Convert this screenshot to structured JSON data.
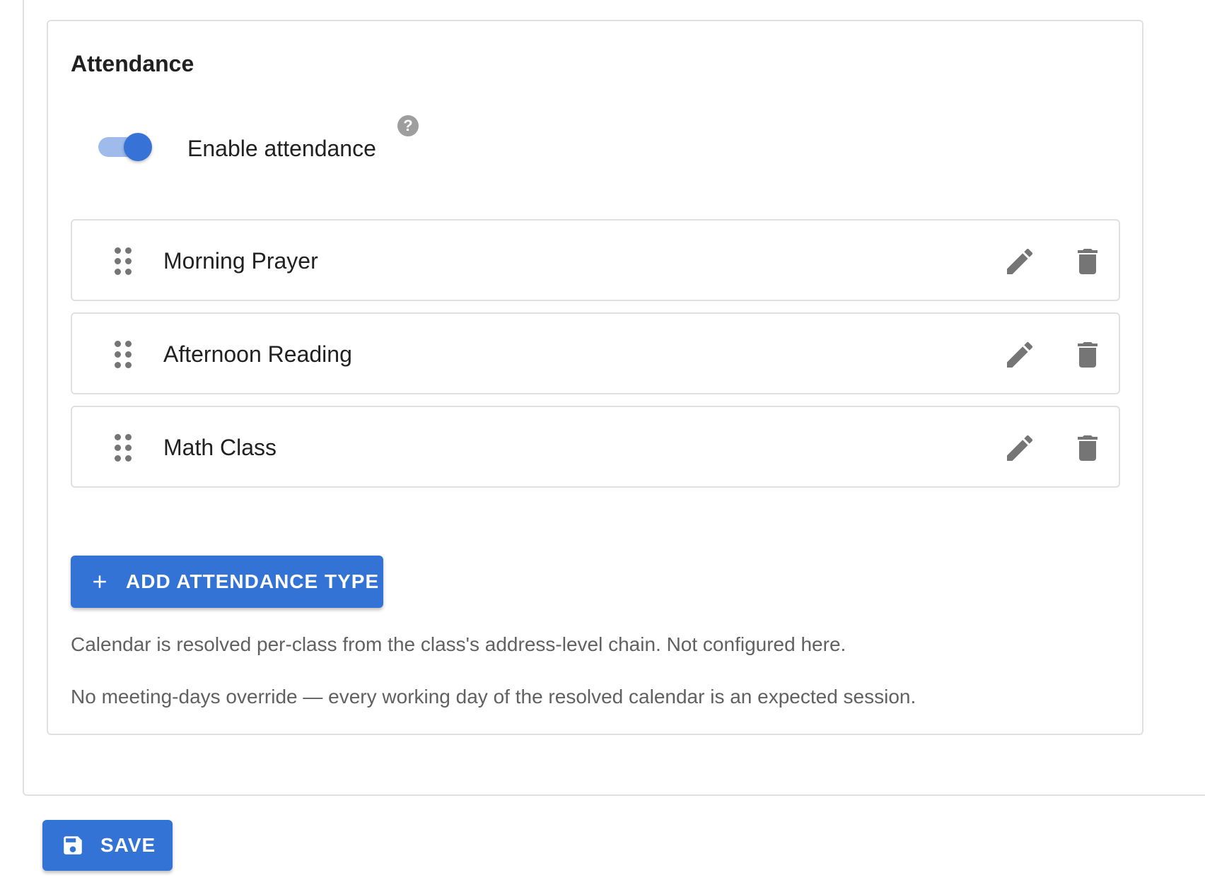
{
  "section": {
    "title": "Attendance"
  },
  "toggle": {
    "label": "Enable attendance",
    "enabled": true,
    "help_icon": "help-circle-icon",
    "help_glyph": "?"
  },
  "attendance_types": [
    {
      "name": "Morning Prayer"
    },
    {
      "name": "Afternoon Reading"
    },
    {
      "name": "Math Class"
    }
  ],
  "row_icons": {
    "drag": "drag-indicator-icon",
    "edit": "pencil-icon",
    "delete": "trash-icon"
  },
  "add_button": {
    "label": "ADD ATTENDANCE TYPE",
    "icon": "plus-icon"
  },
  "info": {
    "calendar_note": "Calendar is resolved per-class from the class's address-level chain. Not configured here.",
    "meeting_days_note": "No meeting-days override — every working day of the resolved calendar is an expected session."
  },
  "save_button": {
    "label": "SAVE",
    "icon": "floppy-disk-icon"
  },
  "colors": {
    "primary": "#3473d6",
    "toggle_track": "#9fbbeb",
    "toggle_thumb": "#3772d6",
    "icon_gray": "#757575",
    "border": "#e0e0e0",
    "secondary_text": "#616161"
  }
}
